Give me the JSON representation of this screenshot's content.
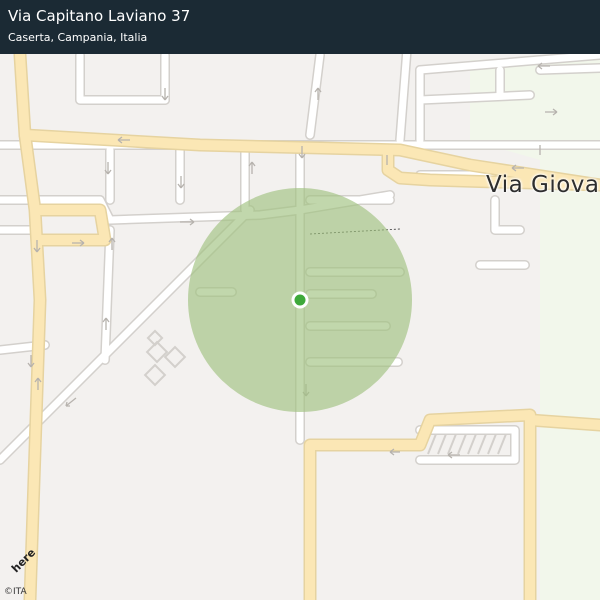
{
  "header": {
    "title": "Via Capitano Laviano 37",
    "subtitle": "Caserta, Campania, Italia"
  },
  "map": {
    "street_label": "Via Giova",
    "copyright": "©ITA",
    "logo_text": "here",
    "colors": {
      "background": "#f3f1ef",
      "minor_road": "#ffffff",
      "minor_road_casing": "#d3d0cc",
      "major_road": "#fbe7b5",
      "major_road_casing": "#e6d3a0",
      "park": "#f2f7eb",
      "accuracy_circle": "#9fc27f",
      "location_marker": "#3ea93a",
      "header_background": "#1b2a34"
    },
    "location_marker_icon": "green-location-dot",
    "accuracy_circle_icon": "accuracy-circle"
  }
}
